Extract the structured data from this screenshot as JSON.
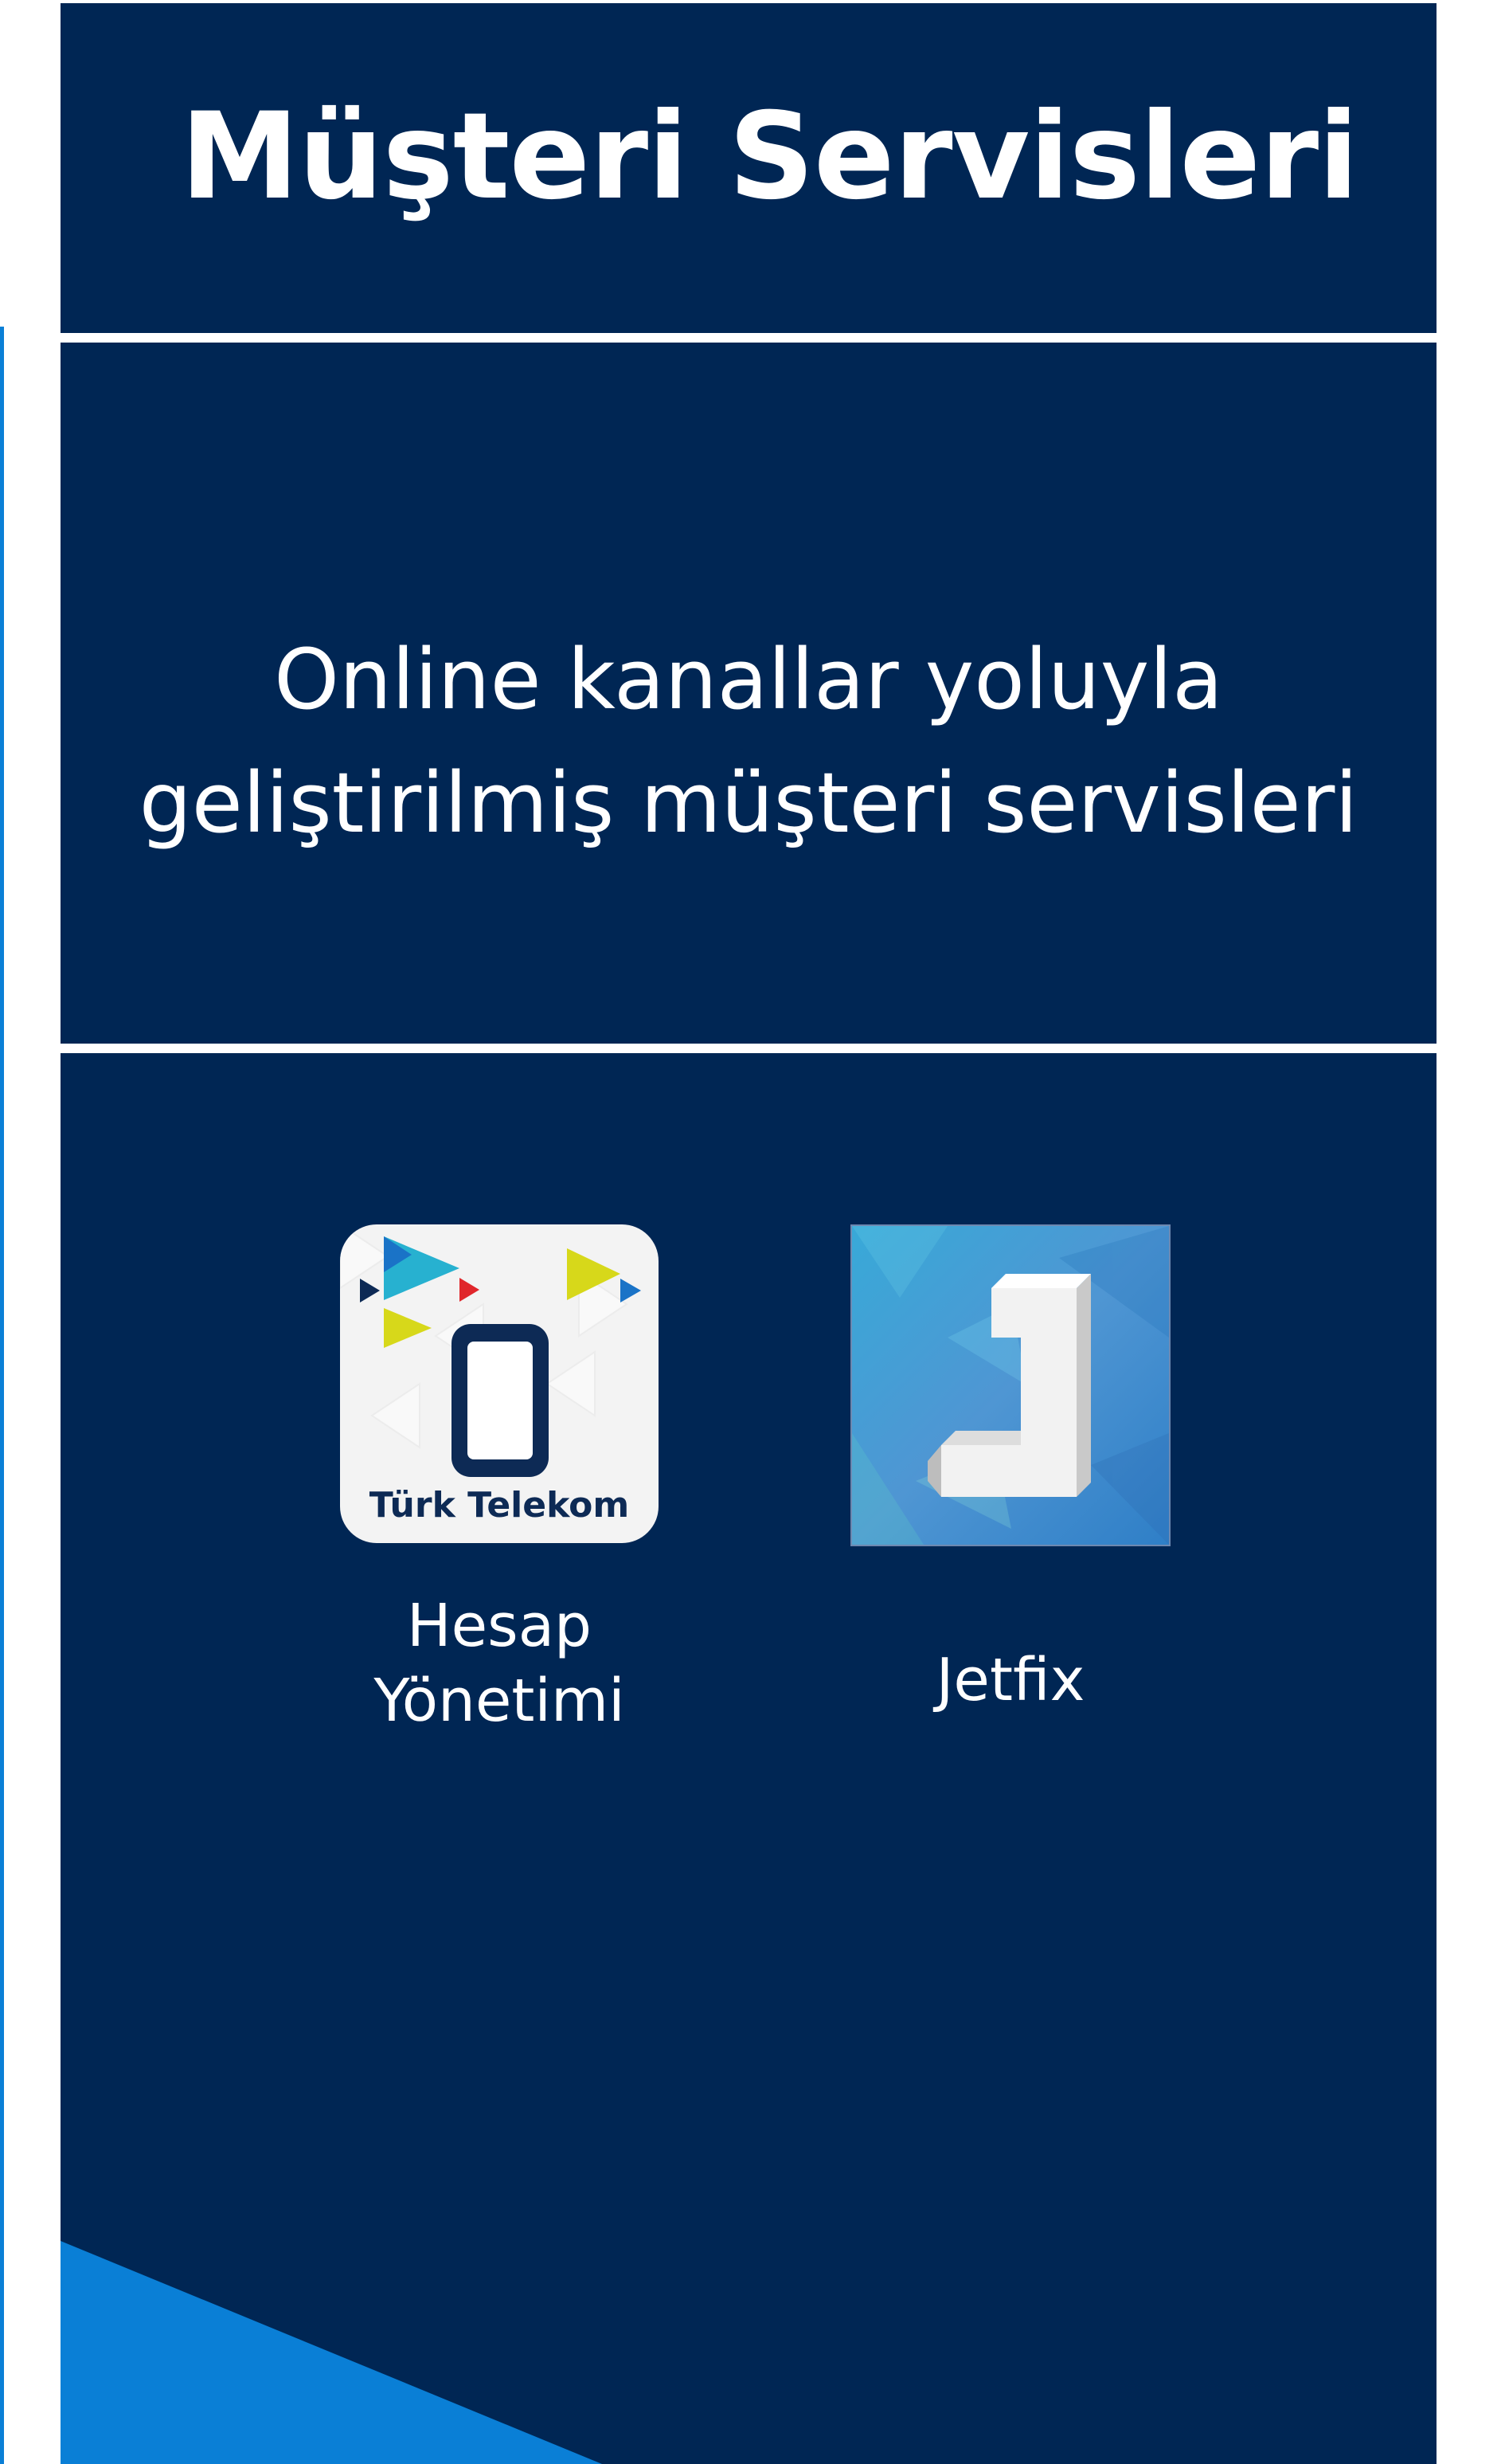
{
  "page": {
    "title": "Müşteri Servisleri",
    "subtitle_lines": [
      "Online kanallar yoluyla",
      "geliştirilmiş müşteri servisleri"
    ]
  },
  "apps": [
    {
      "brand_text": "Türk Telekom",
      "label_lines": [
        "Hesap",
        "Yönetimi"
      ],
      "icon": "turk-telekom-phone-icon"
    },
    {
      "label": "Jetfix",
      "icon": "jetfix-j-icon"
    }
  ],
  "colors": {
    "panel_background": "#002654",
    "divider": "#ffffff",
    "accent_blue": "#0a7fd6",
    "text": "#ffffff"
  }
}
